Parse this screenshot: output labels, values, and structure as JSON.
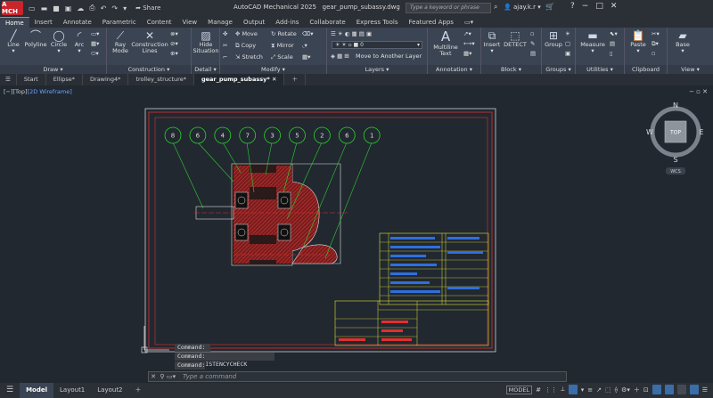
{
  "titlebar": {
    "app_badge": "A MCH",
    "share": "Share",
    "app_title": "AutoCAD Mechanical 2025",
    "file_name": "gear_pump_subassy.dwg",
    "search_placeholder": "Type a keyword or phrase",
    "user": "ajay.k.r"
  },
  "ribbon_tabs": [
    "Home",
    "Insert",
    "Annotate",
    "Parametric",
    "Content",
    "View",
    "Manage",
    "Output",
    "Add-ins",
    "Collaborate",
    "Express Tools",
    "Featured Apps"
  ],
  "ribbon": {
    "draw": {
      "title": "Draw",
      "line": "Line",
      "polyline": "Polyline",
      "circle": "Circle",
      "arc": "Arc"
    },
    "construction": {
      "title": "Construction",
      "ray_mode": "Ray\nMode",
      "construction_lines": "Construction\nLines"
    },
    "detail": {
      "title": "Detail",
      "hide_situation": "Hide\nSituation"
    },
    "modify": {
      "title": "Modify",
      "move": "Move",
      "rotate": "Rotate",
      "copy": "Copy",
      "mirror": "Mirror",
      "stretch": "Stretch",
      "scale": "Scale"
    },
    "layers": {
      "title": "Layers",
      "current_layer": "0",
      "move_to_layer": "Move to Another Layer"
    },
    "annotation": {
      "title": "Annotation",
      "multiline_text": "Multiline\nText"
    },
    "block": {
      "title": "Block",
      "insert": "Insert",
      "detect": "DETECT"
    },
    "groups": {
      "title": "Groups",
      "group": "Group"
    },
    "utilities": {
      "title": "Utilities",
      "measure": "Measure"
    },
    "clipboard": {
      "title": "Clipboard",
      "paste": "Paste"
    },
    "view": {
      "title": "View",
      "base": "Base"
    }
  },
  "doc_tabs": [
    "Start",
    "Ellipse*",
    "Drawing4*",
    "trolley_structure*",
    "gear_pump_subassy*"
  ],
  "viewport": {
    "label_prefix": "[−][Top]",
    "label_style": "[2D Wireframe]",
    "viewcube": {
      "top": "TOP",
      "n": "N",
      "s": "S",
      "e": "E",
      "w": "W",
      "wcs": "WCS"
    },
    "balloons": [
      "8",
      "6",
      "4",
      "7",
      "3",
      "5",
      "2",
      "6",
      "1"
    ]
  },
  "command": {
    "history": [
      "Command:",
      "Command:  _AMSCONSISTENCYCHECK",
      "Command:"
    ],
    "placeholder": "Type a command"
  },
  "status": {
    "tabs": [
      "Model",
      "Layout1",
      "Layout2"
    ],
    "model_label": "MODEL"
  },
  "colors": {
    "ribbon": "#3b4453",
    "canvas": "#212830",
    "border_red": "#e03030",
    "balloon": "#2fd22f",
    "section": "#b22020"
  }
}
